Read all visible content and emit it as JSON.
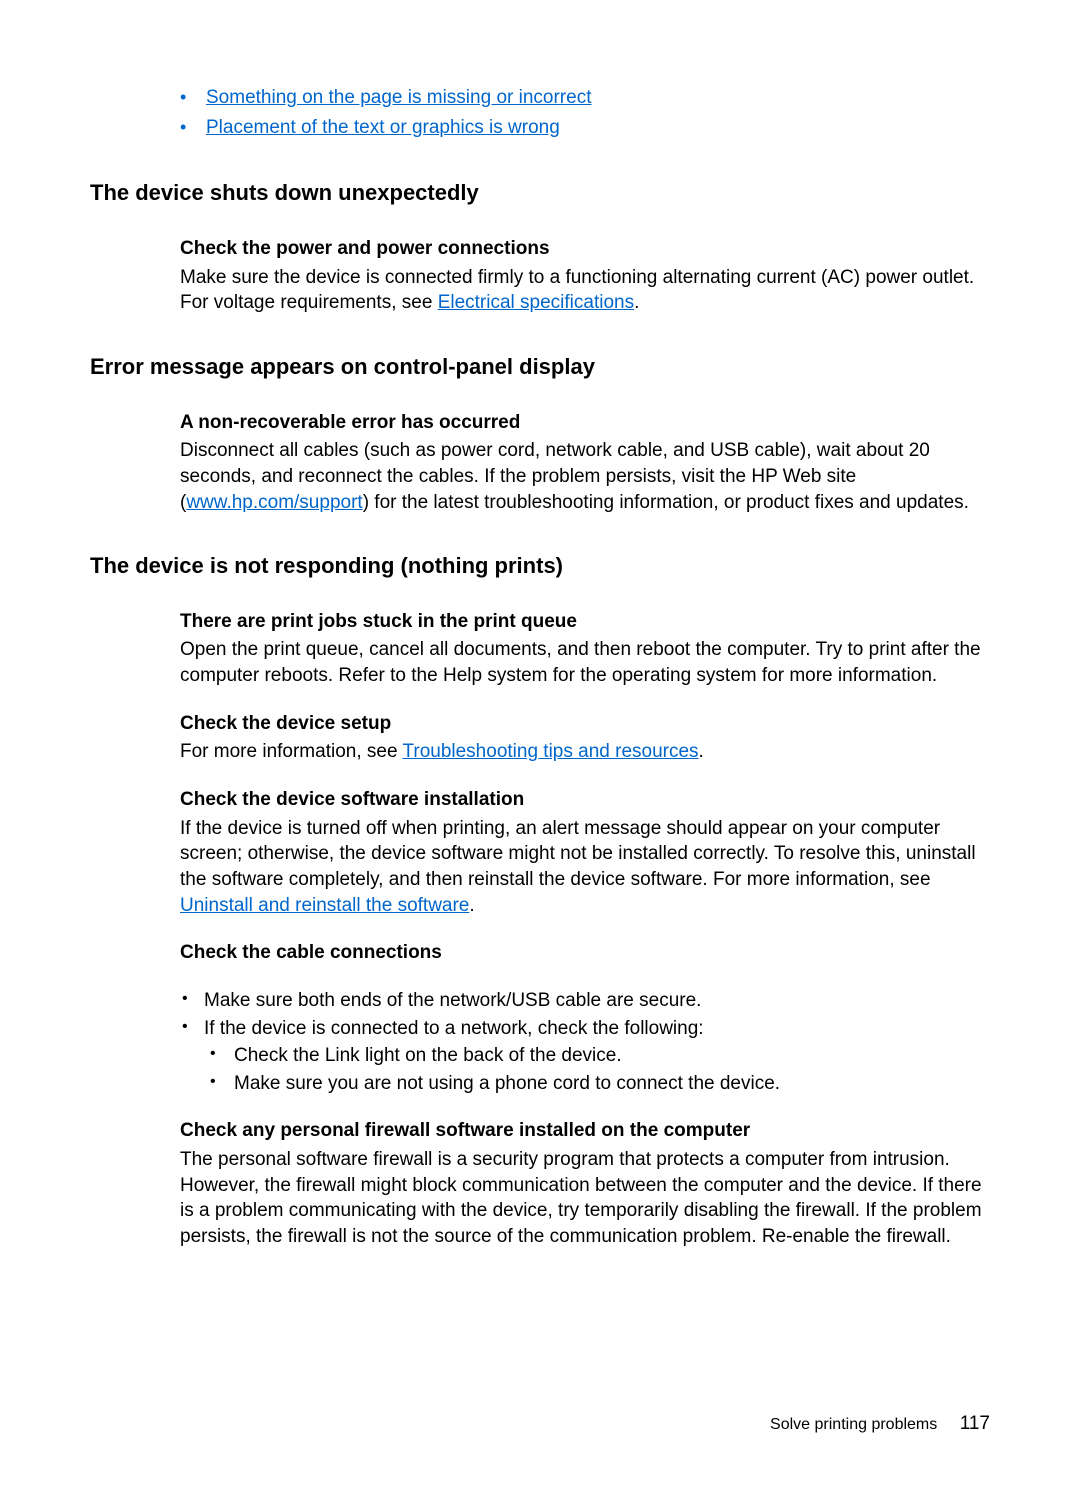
{
  "top_links": {
    "link1": "Something on the page is missing or incorrect",
    "link2": "Placement of the text or graphics is wrong"
  },
  "section1": {
    "title": "The device shuts down unexpectedly",
    "sub1_title": "Check the power and power connections",
    "sub1_text_a": "Make sure the device is connected firmly to a functioning alternating current (AC) power outlet. For voltage requirements, see ",
    "sub1_link": "Electrical specifications",
    "sub1_text_b": "."
  },
  "section2": {
    "title": "Error message appears on control-panel display",
    "sub1_title": "A non-recoverable error has occurred",
    "sub1_text_a": "Disconnect all cables (such as power cord, network cable, and USB cable), wait about 20 seconds, and reconnect the cables. If the problem persists, visit the HP Web site (",
    "sub1_link": "www.hp.com/support",
    "sub1_text_b": ") for the latest troubleshooting information, or product fixes and updates."
  },
  "section3": {
    "title": "The device is not responding (nothing prints)",
    "sub1_title": "There are print jobs stuck in the print queue",
    "sub1_text": "Open the print queue, cancel all documents, and then reboot the computer. Try to print after the computer reboots. Refer to the Help system for the operating system for more information.",
    "sub2_title": "Check the device setup",
    "sub2_text_a": "For more information, see ",
    "sub2_link": "Troubleshooting tips and resources",
    "sub2_text_b": ".",
    "sub3_title": "Check the device software installation",
    "sub3_text_a": "If the device is turned off when printing, an alert message should appear on your computer screen; otherwise, the device software might not be installed correctly. To resolve this, uninstall the software completely, and then reinstall the device software. For more information, see ",
    "sub3_link": "Uninstall and reinstall the software",
    "sub3_text_b": ".",
    "sub4_title": "Check the cable connections",
    "sub4_bullet1": "Make sure both ends of the network/USB cable are secure.",
    "sub4_bullet2": "If the device is connected to a network, check the following:",
    "sub4_subbullet1": "Check the Link light on the back of the device.",
    "sub4_subbullet2": "Make sure you are not using a phone cord to connect the device.",
    "sub5_title": "Check any personal firewall software installed on the computer",
    "sub5_text": "The personal software firewall is a security program that protects a computer from intrusion. However, the firewall might block communication between the computer and the device. If there is a problem communicating with the device, try temporarily disabling the firewall. If the problem persists, the firewall is not the source of the communication problem. Re-enable the firewall."
  },
  "footer": {
    "section": "Solve printing problems",
    "page": "117"
  }
}
